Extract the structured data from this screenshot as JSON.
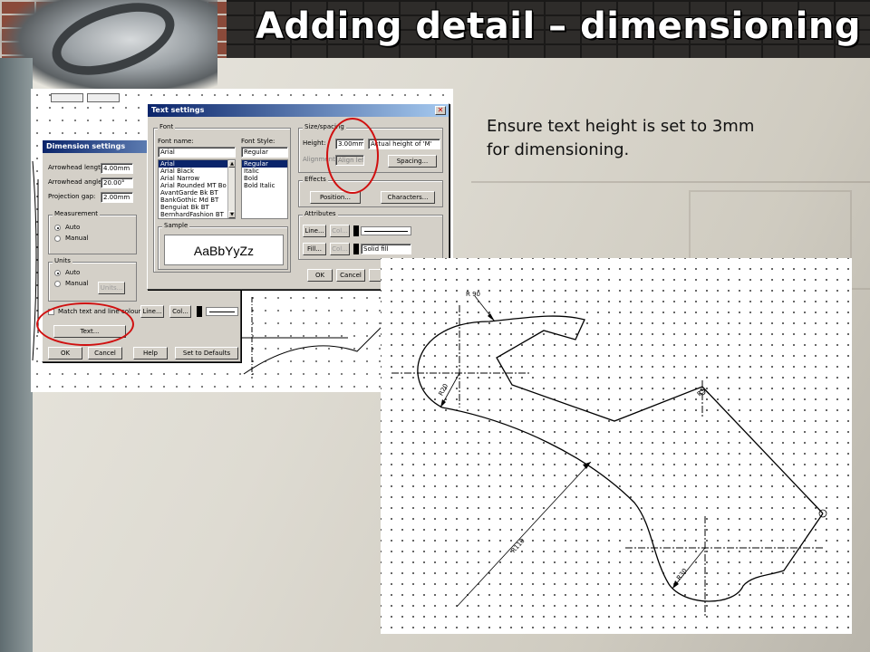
{
  "slide": {
    "title": "Adding detail – dimensioning",
    "body_lines": [
      "Ensure text height is set to 3mm",
      "for dimensioning."
    ]
  },
  "dimension_settings": {
    "title": "Dimension settings",
    "arrowhead_length_label": "Arrowhead length:",
    "arrowhead_length_value": "4.00mm",
    "arrowhead_angle_label": "Arrowhead angle:",
    "arrowhead_angle_value": "20.00°",
    "projection_gap_label": "Projection gap:",
    "projection_gap_value": "2.00mm",
    "measurement_label": "Measurement",
    "measurement_auto": "Auto",
    "measurement_manual": "Manual",
    "units_label": "Units",
    "units_auto": "Auto",
    "units_manual": "Manual",
    "units_button": "Units...",
    "match_colours_label": "Match text and line colours",
    "line_button": "Line...",
    "col_button": "Col...",
    "text_button": "Text...",
    "ok_button": "OK",
    "cancel_button": "Cancel",
    "help_button": "Help",
    "defaults_button": "Set to Defaults"
  },
  "text_settings": {
    "title": "Text settings",
    "font_group": "Font",
    "font_name_label": "Font name:",
    "font_name_value": "Arial",
    "font_list": [
      "Arial",
      "Arial Black",
      "Arial Narrow",
      "Arial Rounded MT Bo",
      "AvantGarde Bk BT",
      "BankGothic Md BT",
      "Benguiat Bk BT",
      "BernhardFashion BT"
    ],
    "font_style_label": "Font Style:",
    "font_style_value": "Regular",
    "style_list": [
      "Regular",
      "Italic",
      "Bold",
      "Bold Italic"
    ],
    "sample_label": "Sample",
    "sample_text": "AaBbYyZz",
    "size_group": "Size/spacing",
    "height_label": "Height:",
    "height_value": "3.00mm",
    "height_mode": "Actual height of 'M'",
    "alignment_label": "Alignment:",
    "alignment_value": "Align left",
    "spacing_button": "Spacing...",
    "effects_group": "Effects",
    "position_button": "Position...",
    "characters_button": "Characters...",
    "attributes_group": "Attributes",
    "line_button": "Line...",
    "col_button_1": "Col...",
    "fill_button": "Fill...",
    "col_button_2": "Col...",
    "fill_value": "Solid fill",
    "ok_button": "OK",
    "cancel_button": "Cancel",
    "help_button": "H"
  },
  "drawing": {
    "dim_r90": "R 90",
    "dim_r20": "R20",
    "dim_r110": "R110",
    "dim_r30": "R30",
    "dim_r5": "R5"
  },
  "colors": {
    "highlight_ring": "#d01010",
    "title_bar": "#0a246a"
  }
}
